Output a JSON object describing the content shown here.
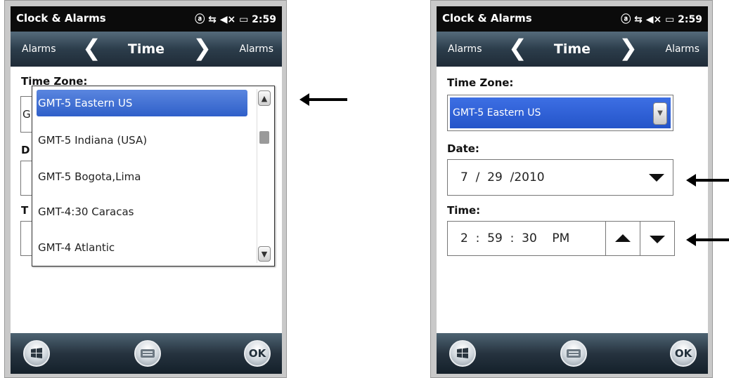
{
  "status": {
    "title": "Clock & Alarms",
    "icons_text": "ⓐ ⇆ ◀× ▭ 2:59",
    "time": "2:59"
  },
  "nav": {
    "left": "Alarms",
    "center": "Time",
    "right": "Alarms",
    "prev_glyph": "❮",
    "next_glyph": "❯"
  },
  "left_screen": {
    "bg_labels": [
      "Time Zone:",
      "D",
      "T"
    ],
    "bg_field_glyph": "G",
    "dropdown_options": [
      {
        "label": "GMT-5 Eastern US",
        "selected": true
      },
      {
        "label": "GMT-5 Indiana (USA)"
      },
      {
        "label": "GMT-5 Bogota,Lima"
      },
      {
        "label": "GMT-4:30 Caracas"
      },
      {
        "label": "GMT-4 Atlantic"
      }
    ]
  },
  "right_screen": {
    "timezone_label": "Time Zone:",
    "timezone_value": "GMT-5 Eastern US",
    "date_label": "Date:",
    "date_value": "7  /  29  /2010",
    "time_label": "Time:",
    "time_value": "2  :  59  :  30    PM"
  },
  "bottom": {
    "ok_label": "OK"
  },
  "icons": [
    "windows-start-icon",
    "keyboard-icon",
    "callout-arrow-icon"
  ],
  "colors": {
    "selection_blue": "#2f5fc9",
    "nav_dark": "#2c3d4b",
    "status_black": "#0b0b0b"
  }
}
